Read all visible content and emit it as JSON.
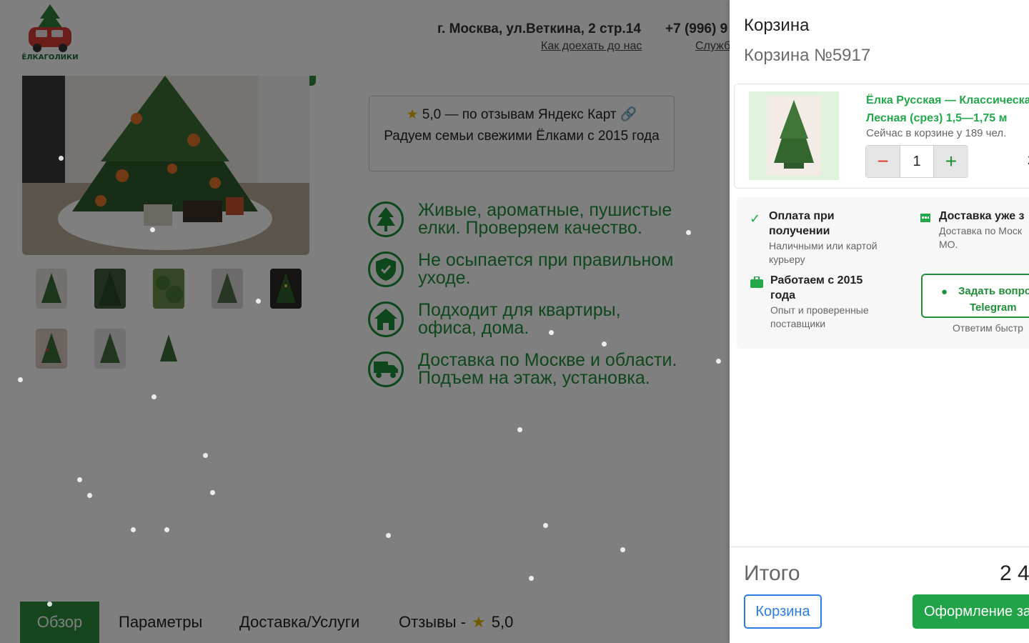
{
  "header": {
    "logo_text": "ЁЛКАГОЛИКИ",
    "address": "г. Москва, ул.Веткина, 2 стр.14",
    "directions_link": "Как доехать до нас",
    "phone": "+7 (996) 9",
    "service_link": "Служб"
  },
  "product": {
    "rating_line": "5,0 — по отзывам Яндекс Карт",
    "rating_tagline": "Радуем семьи свежими Ёлками с 2015 года",
    "features": [
      {
        "icon": "tree-icon",
        "text": "Живые, ароматные, пушистые елки. Проверяем качество."
      },
      {
        "icon": "shield-check-icon",
        "text": "Не осыпается при правильном уходе."
      },
      {
        "icon": "house-icon",
        "text": "Подходит для квартиры, офиса, дома."
      },
      {
        "icon": "truck-icon",
        "text": "Доставка по Москве и области. Подъем на этаж, установка."
      }
    ]
  },
  "tabs": {
    "overview": "Обзор",
    "params": "Параметры",
    "delivery": "Доставка/Услуги",
    "reviews": "Отзывы -",
    "reviews_rating": "5,0"
  },
  "cart": {
    "title": "Корзина",
    "number": "Корзина №5917",
    "item": {
      "name_line1": "Ёлка Русская — Классическа",
      "name_line2": "Лесная (срез) 1,5—1,75 м",
      "in_cart_count": "Сейчас в корзине у 189 чел.",
      "quantity": "1",
      "minus": "−",
      "plus": "+",
      "price_fragment": "2"
    },
    "info": {
      "payment_title_1": "Оплата при",
      "payment_title_2": "получении",
      "payment_text_1": "Наличными или картой",
      "payment_text_2": "курьеру",
      "delivery_title": "Доставка уже з",
      "delivery_text_1": "Доставка по Моск",
      "delivery_text_2": "МО.",
      "since_title_1": "Работаем с 2015",
      "since_title_2": "года",
      "since_text_1": "Опыт и проверенные",
      "since_text_2": "поставщики",
      "telegram_line1": "Задать вопро",
      "telegram_line2": "Telegram",
      "telegram_note": "Ответим быстр"
    },
    "total_label": "Итого",
    "total_value": "2 4",
    "cart_button": "Корзина",
    "checkout_button": "Оформление за"
  },
  "colors": {
    "brand_green": "#2e8b3c",
    "accent_green": "#22a84a",
    "link_blue": "#2a7de1",
    "minus_red": "#e53935"
  }
}
